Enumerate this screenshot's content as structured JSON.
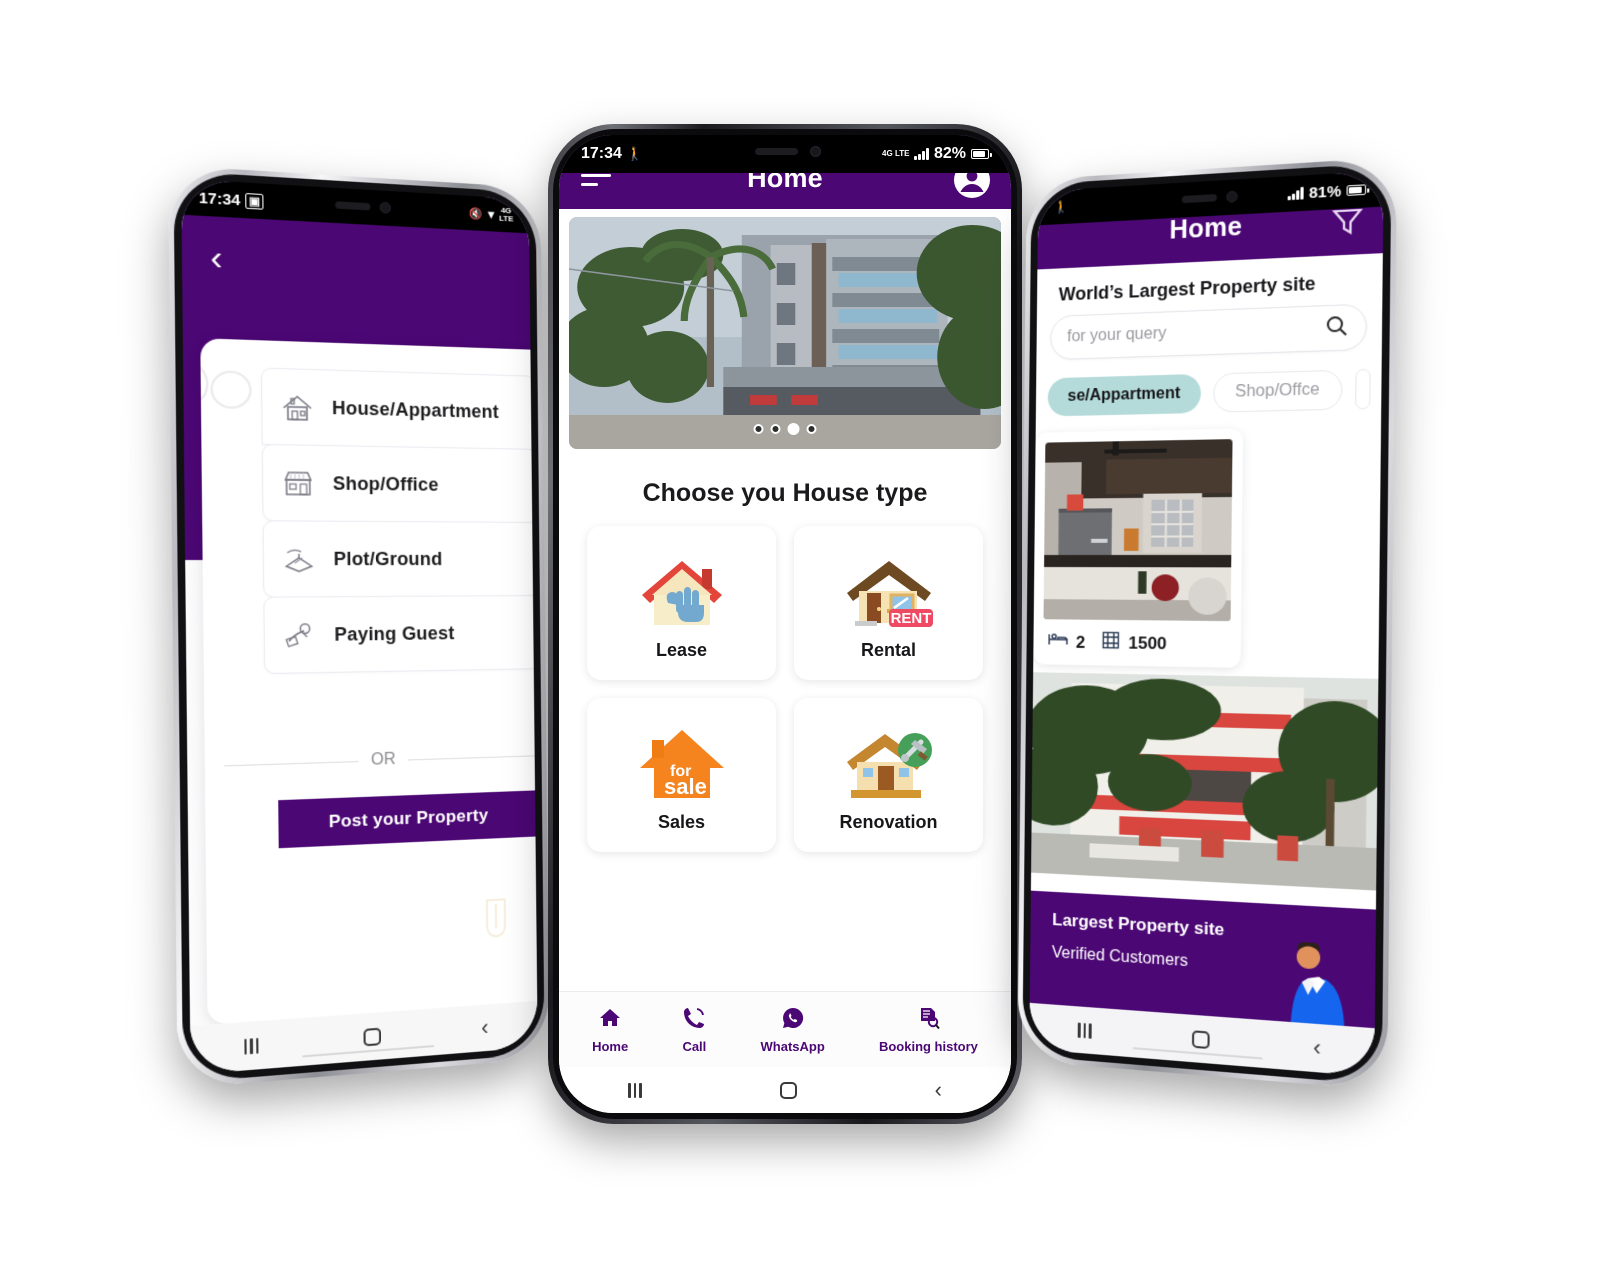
{
  "theme": {
    "purple": "#4B0774",
    "chip_active": "#b4dbd9",
    "white": "#ffffff"
  },
  "left_phone": {
    "status": {
      "time": "17:34",
      "battery": "",
      "icons": "wifi-lte"
    },
    "back_label": "‹",
    "options": [
      {
        "label": "House/Appartment",
        "icon": "house-icon"
      },
      {
        "label": "Shop/Office",
        "icon": "shop-icon"
      },
      {
        "label": "Plot/Ground",
        "icon": "plot-icon"
      },
      {
        "label": "Paying Guest",
        "icon": "paying-guest-icon"
      }
    ],
    "divider_text": "OR",
    "post_button": "Post your Property",
    "nav": {
      "recents": "recents-icon",
      "home": "home-icon",
      "back": "‹"
    }
  },
  "center_phone": {
    "status": {
      "time": "17:34",
      "battery": "82%",
      "network": "4G LTE"
    },
    "appbar": {
      "title": "Home",
      "menu_icon": "hamburger-icon",
      "profile_icon": "account-circle-icon"
    },
    "carousel": {
      "dots": 4,
      "active_index": 2
    },
    "section_title": "Choose you House type",
    "house_types": [
      {
        "label": "Lease",
        "icon": "house-hand-icon"
      },
      {
        "label": "Rental",
        "icon": "house-rent-sign-icon",
        "sign": "RENT"
      },
      {
        "label": "Sales",
        "icon": "house-for-sale-icon",
        "sign_top": "for",
        "sign_bottom": "sale"
      },
      {
        "label": "Renovation",
        "icon": "house-tools-icon"
      }
    ],
    "bottom_nav": [
      {
        "label": "Home",
        "icon": "home-icon"
      },
      {
        "label": "Call",
        "icon": "phone-icon"
      },
      {
        "label": "WhatsApp",
        "icon": "whatsapp-icon"
      },
      {
        "label": "Booking history",
        "icon": "booking-history-icon"
      }
    ],
    "nav": {
      "recents": "recents-icon",
      "home": "home-icon",
      "back": "‹"
    }
  },
  "right_phone": {
    "status": {
      "battery": "81%"
    },
    "appbar": {
      "title": "Home",
      "filter_icon": "filter-funnel-icon"
    },
    "tagline": "World’s Largest Property site",
    "search": {
      "placeholder": "for your query",
      "icon": "search-icon"
    },
    "chips": [
      {
        "label": "se/Appartment",
        "state": "active"
      },
      {
        "label": "Shop/Offce",
        "state": "idle"
      }
    ],
    "property_card": {
      "beds_icon": "bed-icon",
      "beds": "2",
      "area_icon": "area-icon",
      "area": "1500"
    },
    "promo": {
      "line1": "Largest Property site",
      "line2": "Verified Customers"
    },
    "nav": {
      "recents": "recents-icon",
      "home": "home-icon",
      "back": "‹"
    }
  }
}
